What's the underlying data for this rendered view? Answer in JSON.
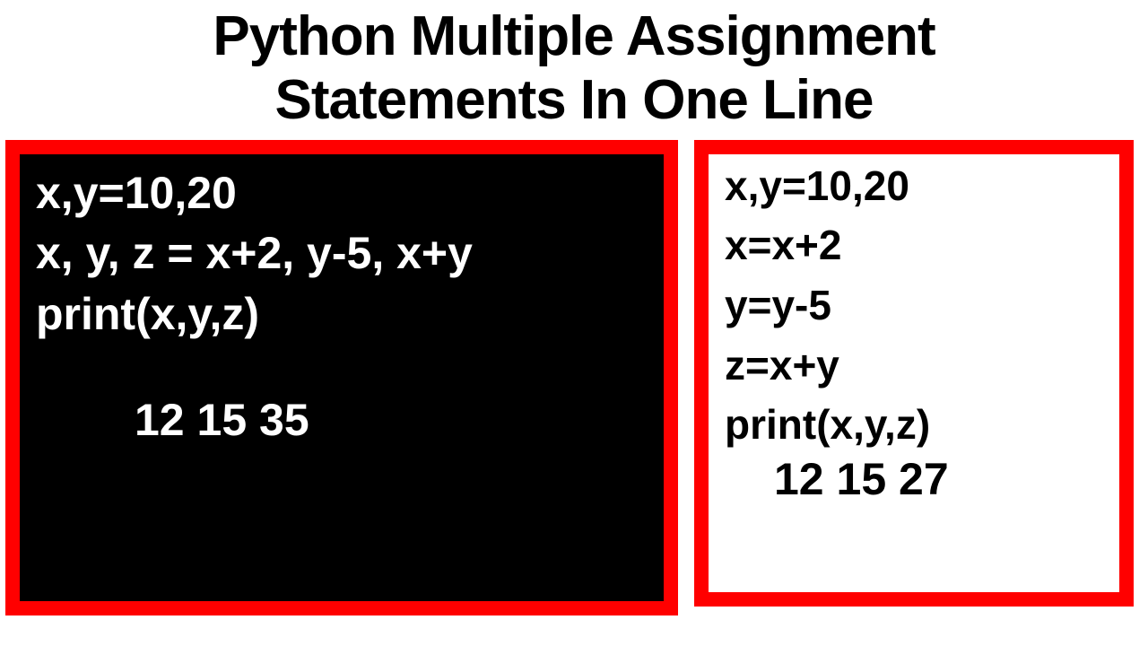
{
  "title_line1": "Python Multiple Assignment",
  "title_line2": "Statements In One Line",
  "left_box": {
    "line1": "x,y=10,20",
    "line2": "x, y, z = x+2, y-5, x+y",
    "line3": "print(x,y,z)",
    "output": "12 15 35"
  },
  "right_box": {
    "line1": "x,y=10,20",
    "line2": "x=x+2",
    "line3": "y=y-5",
    "line4": "z=x+y",
    "line5": "print(x,y,z)",
    "output": "12 15 27"
  }
}
